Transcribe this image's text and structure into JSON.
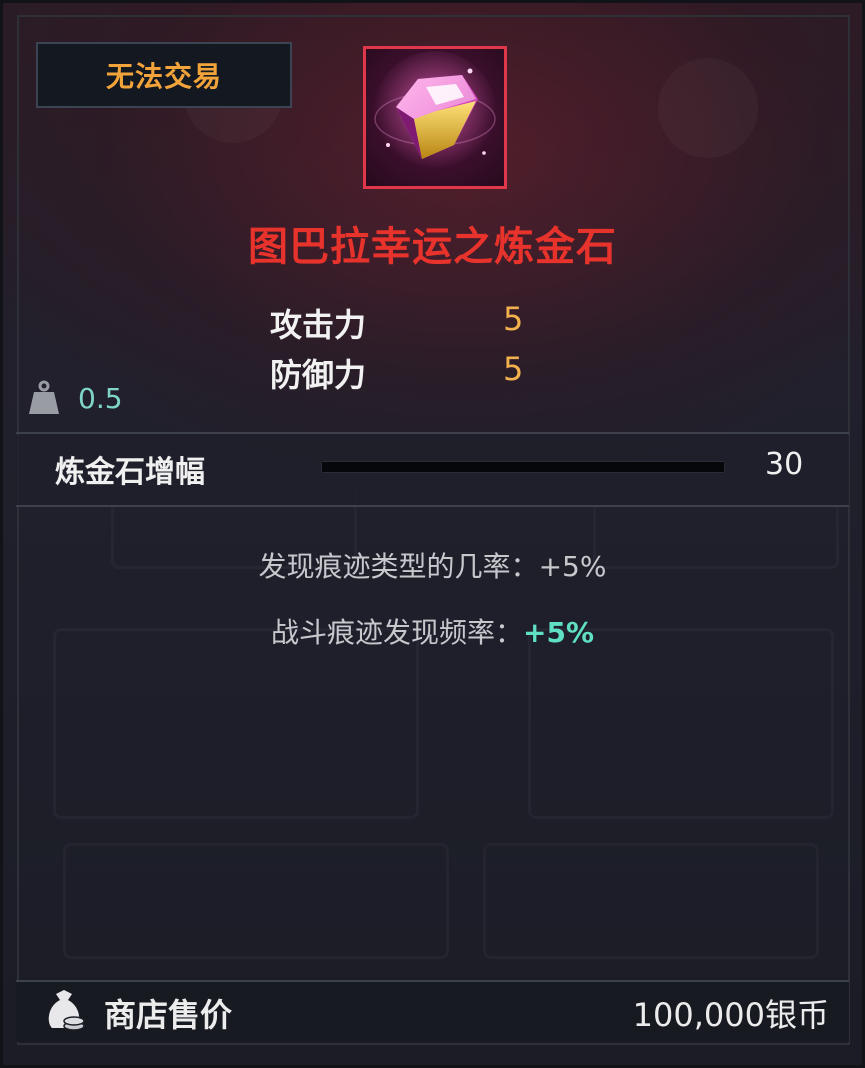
{
  "badge": {
    "label": "无法交易"
  },
  "item": {
    "name": "图巴拉幸运之炼金石",
    "icon": "gem-icon",
    "colors": {
      "name": "#e8322c",
      "border": "#e0384a"
    }
  },
  "stats": [
    {
      "label": "攻击力",
      "value": "5"
    },
    {
      "label": "防御力",
      "value": "5"
    }
  ],
  "weight": {
    "icon": "weight-icon",
    "value": "0.5"
  },
  "enhancement": {
    "label": "炼金石增幅",
    "value": "30"
  },
  "effects": [
    {
      "label": "发现痕迹类型的几率：",
      "value": "+5%"
    },
    {
      "label": "战斗痕迹发现频率：",
      "value": "+5%"
    }
  ],
  "price": {
    "icon": "money-bag-icon",
    "label": "商店售价",
    "value": "100,000银币"
  }
}
